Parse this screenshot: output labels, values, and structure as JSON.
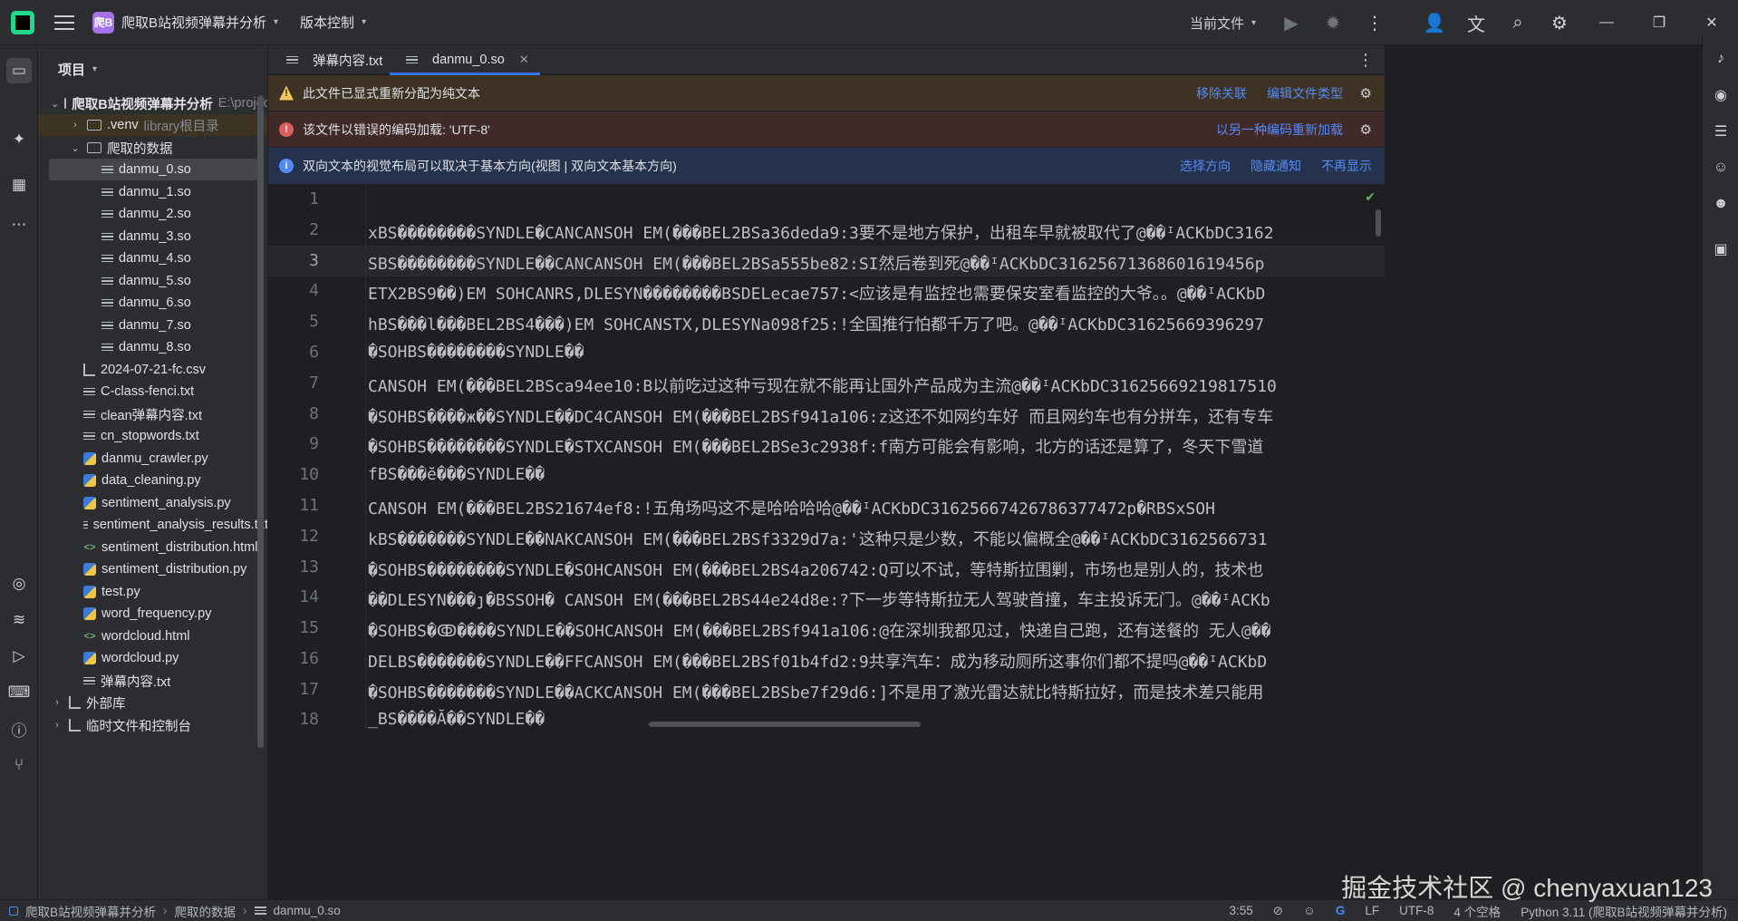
{
  "titlebar": {
    "project_badge": "爬B",
    "project_name": "爬取B站视频弹幕并分析",
    "vcs_label": "版本控制",
    "current_file_label": "当前文件"
  },
  "panel": {
    "title": "项目",
    "tree": [
      {
        "label": "爬取B站视频弹幕并分析",
        "hint": "E:\\project\\"
      },
      {
        "label": ".venv",
        "hint": "library根目录"
      },
      {
        "label": "爬取的数据"
      },
      {
        "label": "danmu_0.so"
      },
      {
        "label": "danmu_1.so"
      },
      {
        "label": "danmu_2.so"
      },
      {
        "label": "danmu_3.so"
      },
      {
        "label": "danmu_4.so"
      },
      {
        "label": "danmu_5.so"
      },
      {
        "label": "danmu_6.so"
      },
      {
        "label": "danmu_7.so"
      },
      {
        "label": "danmu_8.so"
      },
      {
        "label": "2024-07-21-fc.csv"
      },
      {
        "label": "C-class-fenci.txt"
      },
      {
        "label": "clean弹幕内容.txt"
      },
      {
        "label": "cn_stopwords.txt"
      },
      {
        "label": "danmu_crawler.py"
      },
      {
        "label": "data_cleaning.py"
      },
      {
        "label": "sentiment_analysis.py"
      },
      {
        "label": "sentiment_analysis_results.txt"
      },
      {
        "label": "sentiment_distribution.html"
      },
      {
        "label": "sentiment_distribution.py"
      },
      {
        "label": "test.py"
      },
      {
        "label": "word_frequency.py"
      },
      {
        "label": "wordcloud.html"
      },
      {
        "label": "wordcloud.py"
      },
      {
        "label": "弹幕内容.txt"
      },
      {
        "label": "外部库"
      },
      {
        "label": "临时文件和控制台"
      }
    ]
  },
  "tabs": [
    {
      "label": "弹幕内容.txt"
    },
    {
      "label": "danmu_0.so"
    }
  ],
  "banners": {
    "warning": {
      "text": "此文件已显式重新分配为纯文本",
      "links": [
        "移除关联",
        "编辑文件类型"
      ]
    },
    "error": {
      "text": "该文件以错误的编码加载: 'UTF-8'",
      "links": [
        "以另一种编码重新加载"
      ]
    },
    "info": {
      "text": "双向文本的视觉布局可以取决于基本方向(视图 | 双向文本基本方向)",
      "links": [
        "选择方向",
        "隐藏通知",
        "不再显示"
      ]
    }
  },
  "editor": {
    "line_numbers": [
      "1",
      "2",
      "3",
      "4",
      "5",
      "6",
      "7",
      "8",
      "9",
      "10",
      "11",
      "12",
      "13",
      "14",
      "15",
      "16",
      "17",
      "18"
    ],
    "lines": [
      "",
      "xBS��������SYNDLE�CANCANSOH EM(���BEL2BSa36deda9:3要不是地方保护，出租车早就被取代了@��ᴵACKbDC3162",
      "SBS��������SYNDLE��CANCANSOH EM(���BEL2BSa555be82:SI然后卷到死@��ᴵACKbDC31625671368601619456p",
      "ETX2BS9��)EM SOHCANRS,DLESYN��������BSDELecae757:<应该是有监控也需要保安室看监控的大爷。。@��ᴵACKbD",
      "hBS���l���BEL2BS4���)EM SOHCANSTX,DLESYNa098f25:!全国推行怕都千万了吧。@��ᴵACKbDC31625669396297",
      "�SOHBS��������SYNDLE��",
      "CANSOH EM(���BEL2BSca94ee10:B以前吃过这种亏现在就不能再让国外产品成为主流@��ᴵACKbDC31625669219817510",
      "�SOHBS����ж��SYNDLE��DC4CANSOH EM(���BEL2BSf941a106:z这还不如网约车好 而且网约车也有分拼车，还有专车",
      "�SOHBS��������SYNDLE�STXCANSOH EM(���BEL2BSe3c2938f:f南方可能会有影响，北方的话还是算了，冬天下雪道",
      "fBS���ĕ���SYNDLE��",
      "CANSOH EM(���BEL2BS21674ef8:!五角场吗这不是哈哈哈哈@��ᴵACKbDC31625667426786377472p�RBSxSOH",
      "kBS�������SYNDLE��NAKCANSOH EM(���BEL2BSf3329d7a:'这种只是少数，不能以偏概全@��ᴵACKbDC3162566731",
      "�SOHBS��������SYNDLE�SOHCANSOH EM(���BEL2BS4a206742:Q可以不试，等特斯拉围剿，市场也是别人的，技术也",
      "��DLESYN���ȷ�BSSOH� CANSOH EM(���BEL2BS44e24d8e:?下一步等特斯拉无人驾驶首撞，车主投诉无门。@��ᴵACKb",
      "�SOHBS�ↂ����SYNDLE��SOHCANSOH EM(���BEL2BSf941a106:@在深圳我都见过，快递自己跑，还有送餐的 无人@��",
      "DELBS�������SYNDLE��FFCANSOH EM(���BEL2BSf01b4fd2:9共享汽车：成为移动厕所这事你们都不提吗@��ᴵACKbD",
      "�SOHBS�������SYNDLE��ACKCANSOH EM(���BEL2BSbe7f29d6:]不是用了激光雷达就比特斯拉好，而是技术差只能用",
      "_BS����Ă��SYNDLE��"
    ]
  },
  "status": {
    "crumbs": [
      "爬取B站视频弹幕并分析",
      "爬取的数据",
      "danmu_0.so"
    ],
    "position": "3:55",
    "line_sep": "LF",
    "encoding": "UTF-8",
    "indent": "4 个空格",
    "interpreter": "Python 3.11 (爬取B站视频弹幕并分析)"
  },
  "watermark": "掘金技术社区 @ chenyaxuan123"
}
